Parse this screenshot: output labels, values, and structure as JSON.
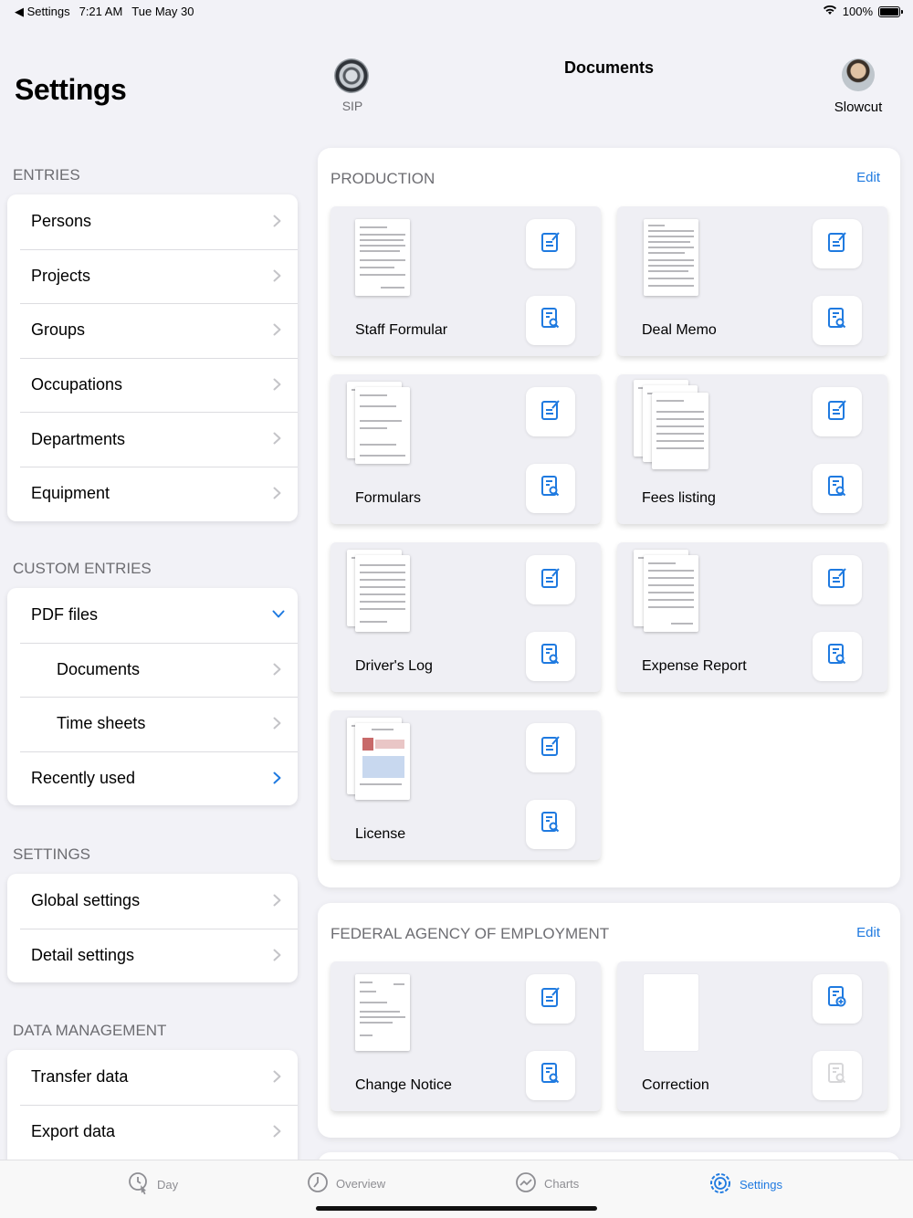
{
  "status": {
    "back_app": "Settings",
    "time": "7:21 AM",
    "date": "Tue May 30",
    "battery": "100%"
  },
  "sidebar": {
    "title": "Settings",
    "sections": [
      {
        "header": "ENTRIES",
        "items": [
          {
            "label": "Persons"
          },
          {
            "label": "Projects"
          },
          {
            "label": "Groups"
          },
          {
            "label": "Occupations"
          },
          {
            "label": "Departments"
          },
          {
            "label": "Equipment"
          }
        ]
      },
      {
        "header": "CUSTOM ENTRIES",
        "items": [
          {
            "label": "PDF files"
          },
          {
            "label": "Documents"
          },
          {
            "label": "Time sheets"
          },
          {
            "label": "Recently used"
          }
        ]
      },
      {
        "header": "SETTINGS",
        "items": [
          {
            "label": "Global settings"
          },
          {
            "label": "Detail settings"
          }
        ]
      },
      {
        "header": "DATA MANAGEMENT",
        "items": [
          {
            "label": "Transfer data"
          },
          {
            "label": "Export data"
          }
        ]
      }
    ]
  },
  "header": {
    "left_label": "SIP",
    "title": "Documents",
    "user_label": "Slowcut"
  },
  "panels": [
    {
      "title": "PRODUCTION",
      "edit_label": "Edit",
      "tiles": [
        {
          "name": "Staff Formular"
        },
        {
          "name": "Deal Memo"
        },
        {
          "name": "Formulars"
        },
        {
          "name": "Fees listing"
        },
        {
          "name": "Driver's Log"
        },
        {
          "name": "Expense Report"
        },
        {
          "name": "License"
        }
      ]
    },
    {
      "title": "FEDERAL AGENCY OF EMPLOYMENT",
      "edit_label": "Edit",
      "tiles": [
        {
          "name": "Change Notice"
        },
        {
          "name": "Correction"
        }
      ]
    }
  ],
  "tabbar": [
    {
      "label": "Day",
      "icon": "day-clock-icon"
    },
    {
      "label": "Overview",
      "icon": "overview-clock-icon"
    },
    {
      "label": "Charts",
      "icon": "charts-icon"
    },
    {
      "label": "Settings",
      "icon": "settings-gear-icon",
      "active": true
    }
  ],
  "colors": {
    "accent": "#1f7ae0",
    "background": "#f2f2f7",
    "secondary_text": "#6d6d72"
  }
}
